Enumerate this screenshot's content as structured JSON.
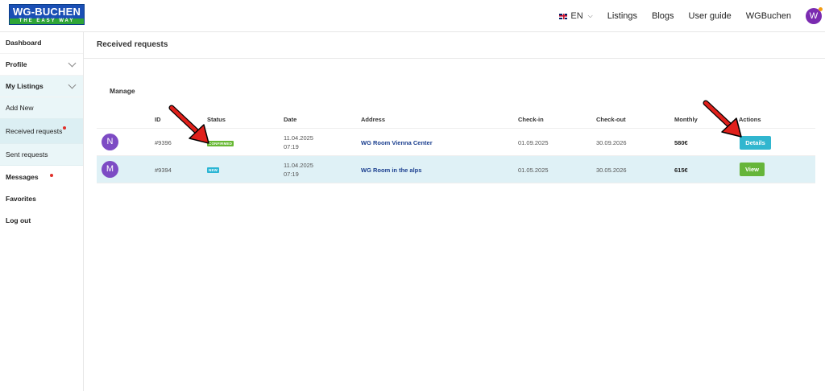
{
  "header": {
    "logo_top": "WG-BUCHEN",
    "logo_bottom": "THE EASY WAY",
    "lang": "EN",
    "nav": [
      "Listings",
      "Blogs",
      "User guide",
      "WGBuchen"
    ],
    "avatar_letter": "W"
  },
  "sidebar": {
    "items": [
      {
        "label": "Dashboard"
      },
      {
        "label": "Profile"
      },
      {
        "label": "My Listings"
      },
      {
        "label": "Add New"
      },
      {
        "label": "Received requests"
      },
      {
        "label": "Sent requests"
      },
      {
        "label": "Messages"
      },
      {
        "label": "Favorites"
      },
      {
        "label": "Log out"
      }
    ]
  },
  "main": {
    "title": "Received requests",
    "section": "Manage",
    "columns": [
      "ID",
      "Status",
      "Date",
      "Address",
      "Check-in",
      "Check-out",
      "Monthly",
      "Actions"
    ],
    "rows": [
      {
        "avatar": "N",
        "id": "#9396",
        "status": "CONFIRMED",
        "date": "11.04.2025",
        "time": "07:19",
        "address": "WG Room Vienna Center",
        "checkin": "01.09.2025",
        "checkout": "30.09.2026",
        "monthly": "580€",
        "action": "Details"
      },
      {
        "avatar": "M",
        "id": "#9394",
        "status": "NEW",
        "date": "11.04.2025",
        "time": "07:19",
        "address": "WG Room in the alps",
        "checkin": "01.05.2025",
        "checkout": "30.05.2026",
        "monthly": "615€",
        "action": "View"
      }
    ]
  },
  "colors": {
    "accent": "#31b6cf",
    "confirmed": "#67b833",
    "view": "#66b53a",
    "arrow": "#e0201b"
  }
}
